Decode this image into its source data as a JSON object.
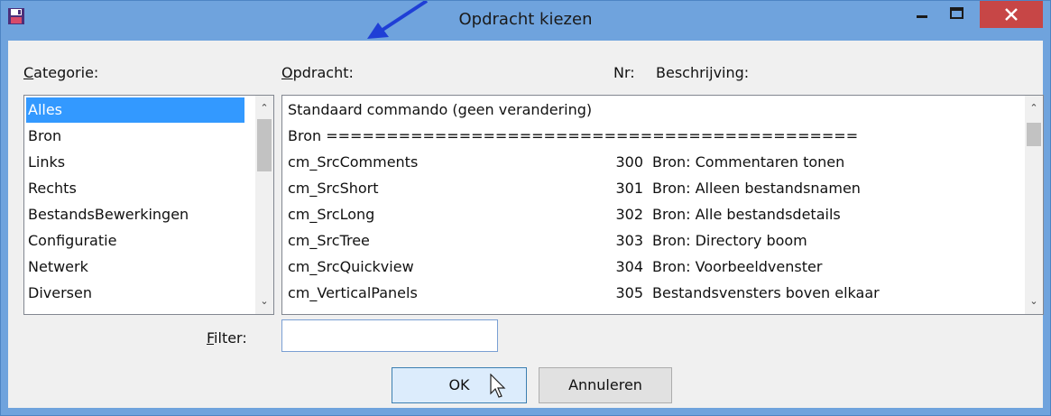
{
  "window": {
    "title": "Opdracht kiezen"
  },
  "labels": {
    "category_prefix": "C",
    "category_rest": "ategorie:",
    "command_prefix": "O",
    "command_rest": "pdracht:",
    "nr": "Nr:",
    "description": "Beschrijving:",
    "filter_prefix": "F",
    "filter_rest": "ilter:"
  },
  "categories": [
    "Alles",
    "Bron",
    "Links",
    "Rechts",
    "BestandsBewerkingen",
    "Configuratie",
    "Netwerk",
    "Diversen"
  ],
  "selected_category": "Alles",
  "commands": [
    {
      "name": "Standaard commando (geen verandering)",
      "nr": "",
      "desc": ""
    },
    {
      "name": "Bron ============================================",
      "nr": "",
      "desc": ""
    },
    {
      "name": "cm_SrcComments",
      "nr": "300",
      "desc": "Bron: Commentaren tonen"
    },
    {
      "name": "cm_SrcShort",
      "nr": "301",
      "desc": "Bron: Alleen bestandsnamen"
    },
    {
      "name": "cm_SrcLong",
      "nr": "302",
      "desc": "Bron: Alle bestandsdetails"
    },
    {
      "name": "cm_SrcTree",
      "nr": "303",
      "desc": "Bron: Directory boom"
    },
    {
      "name": "cm_SrcQuickview",
      "nr": "304",
      "desc": "Bron: Voorbeeldvenster"
    },
    {
      "name": "cm_VerticalPanels",
      "nr": "305",
      "desc": "Bestandsvensters boven elkaar"
    }
  ],
  "filter": {
    "value": ""
  },
  "buttons": {
    "ok": "OK",
    "cancel": "Annuleren"
  },
  "colors": {
    "titlebar": "#6fa3dd",
    "selection": "#3399ff",
    "close": "#c74646"
  }
}
